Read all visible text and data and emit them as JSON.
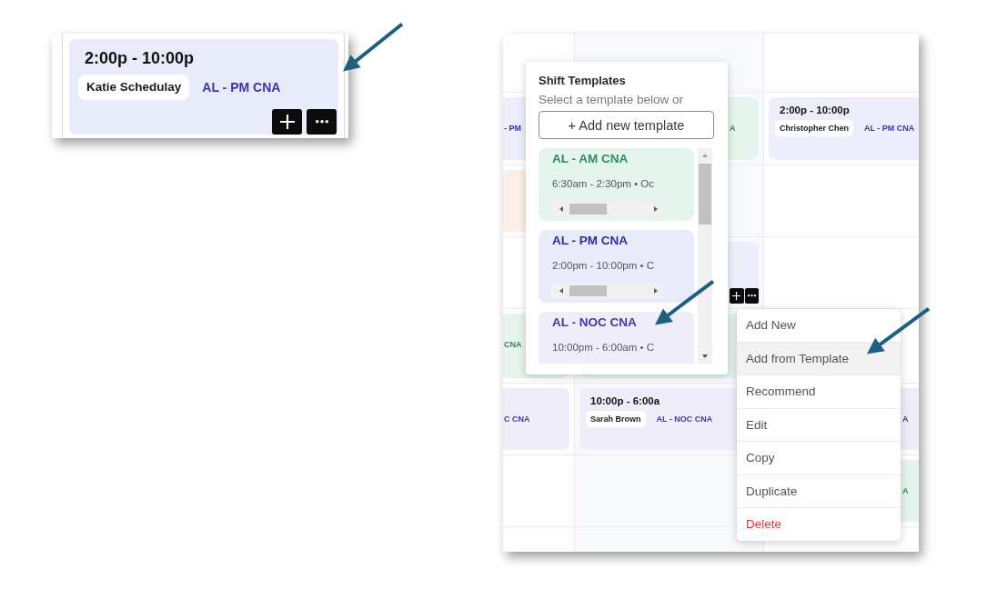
{
  "closeup": {
    "card": {
      "color": "#e8ebfa",
      "time": "2:00p - 10:00p",
      "employee": "Katie Schedulay",
      "role": {
        "text": "AL - PM CNA",
        "color": "#3a36a8"
      },
      "hovered": true
    }
  },
  "schedule": {
    "rows": [
      {
        "cells": [
          {
            "kind": "empty"
          },
          {
            "kind": "empty"
          },
          {
            "kind": "empty"
          }
        ]
      },
      {
        "cells": [
          {
            "kind": "shift",
            "color": "#eceefb",
            "role": {
              "text": "- PM",
              "color": "#3434a8"
            }
          },
          {
            "kind": "shift",
            "color": "#e5f4ed",
            "role": {
              "text": "A",
              "color": "#2e8a62"
            },
            "hovered": false
          },
          {
            "kind": "shift",
            "color": "#eceefb",
            "time": "2:00p - 10:00p",
            "employee": "Christopher Chen",
            "role": {
              "text": "AL - PM CNA",
              "color": "#3434a8"
            },
            "hovered": false
          }
        ]
      },
      {
        "cells": [
          {
            "kind": "shift",
            "color": "#fcefe6"
          },
          {
            "kind": "empty"
          },
          {
            "kind": "empty"
          }
        ]
      },
      {
        "cells": [
          {
            "kind": "empty"
          },
          {
            "kind": "shift",
            "color": "#eceefb",
            "hovered": true
          },
          {
            "kind": "empty"
          }
        ]
      },
      {
        "cells": [
          {
            "kind": "shift",
            "color": "#e5f4ed",
            "role": {
              "text": "CNA",
              "color": "#2e8a62"
            },
            "hovered": false
          },
          {
            "kind": "shift",
            "color": "#e5f4ed",
            "hovered": false
          },
          {
            "kind": "empty"
          }
        ]
      },
      {
        "cells": [
          {
            "kind": "shift",
            "color": "#efedfa",
            "role": {
              "text": "C CNA",
              "color": "#4b35a3"
            },
            "hovered": false
          },
          {
            "kind": "shift",
            "color": "#efedfa",
            "time": "10:00p - 6:00a",
            "employee": "Sarah Brown",
            "role": {
              "text": "AL - NOC CNA",
              "color": "#4b35a3"
            },
            "hovered": false
          },
          {
            "kind": "shift",
            "color": "#efedfa",
            "role": {
              "text": "A",
              "color": "#4b35a3"
            },
            "hovered": false
          }
        ]
      },
      {
        "cells": [
          {
            "kind": "empty"
          },
          {
            "kind": "empty"
          },
          {
            "kind": "shift",
            "color": "#e5f4ed",
            "role": {
              "text": "A",
              "color": "#2e8a62"
            },
            "hovered": false
          }
        ]
      },
      {
        "cells": [
          {
            "kind": "empty"
          },
          {
            "kind": "empty"
          },
          {
            "kind": "empty"
          }
        ]
      }
    ]
  },
  "template_popup": {
    "title": "Shift Templates",
    "subtitle": "Select a template below or",
    "add_button": "+ Add new template",
    "templates": [
      {
        "name": {
          "text": "AL - AM CNA",
          "color": "#2e8a62"
        },
        "hours": "6:30am - 2:30pm • Oc",
        "color": "#e5f4ed"
      },
      {
        "name": {
          "text": "AL - PM CNA",
          "color": "#2c2ca6"
        },
        "hours": "2:00pm - 10:00pm • C",
        "color": "#e9ebfb"
      },
      {
        "name": {
          "text": "AL - NOC CNA",
          "color": "#4b35a3"
        },
        "hours": "10:00pm - 6:00am • C",
        "color": "#efedfa"
      }
    ]
  },
  "context_menu": {
    "items": [
      {
        "label": "Add New",
        "highlighted": false,
        "danger": false
      },
      {
        "label": "Add from Template",
        "highlighted": true,
        "danger": false
      },
      {
        "label": "Recommend",
        "highlighted": false,
        "danger": false
      },
      {
        "label": "Edit",
        "highlighted": false,
        "danger": false
      },
      {
        "label": "Copy",
        "highlighted": false,
        "danger": false
      },
      {
        "label": "Duplicate",
        "highlighted": false,
        "danger": false
      },
      {
        "label": "Delete",
        "highlighted": false,
        "danger": true
      }
    ]
  }
}
